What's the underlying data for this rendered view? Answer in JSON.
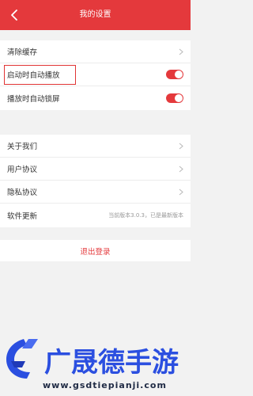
{
  "header": {
    "title": "我的设置",
    "back_icon": "chevron-left-icon"
  },
  "colors": {
    "accent": "#e4393c",
    "highlight": "#e03434",
    "watermark_blue": "#2b4fe0",
    "watermark_dark": "#1f2a44"
  },
  "section1": {
    "clear_cache": "清除缓存",
    "autoplay_on_start": "启动时自动播放",
    "autoplay_on_start_enabled": true,
    "lock_screen_on_play": "播放时自动锁屏",
    "lock_screen_on_play_enabled": true
  },
  "section2": {
    "about": "关于我们",
    "user_agreement": "用户协议",
    "privacy": "隐私协议",
    "update": "软件更新",
    "version_status": "当前版本3.0.3，已是最新版本"
  },
  "logout": "退出登录",
  "watermark": {
    "brand": "广晟德手游",
    "url": "www.gsdtiepianji.com"
  }
}
